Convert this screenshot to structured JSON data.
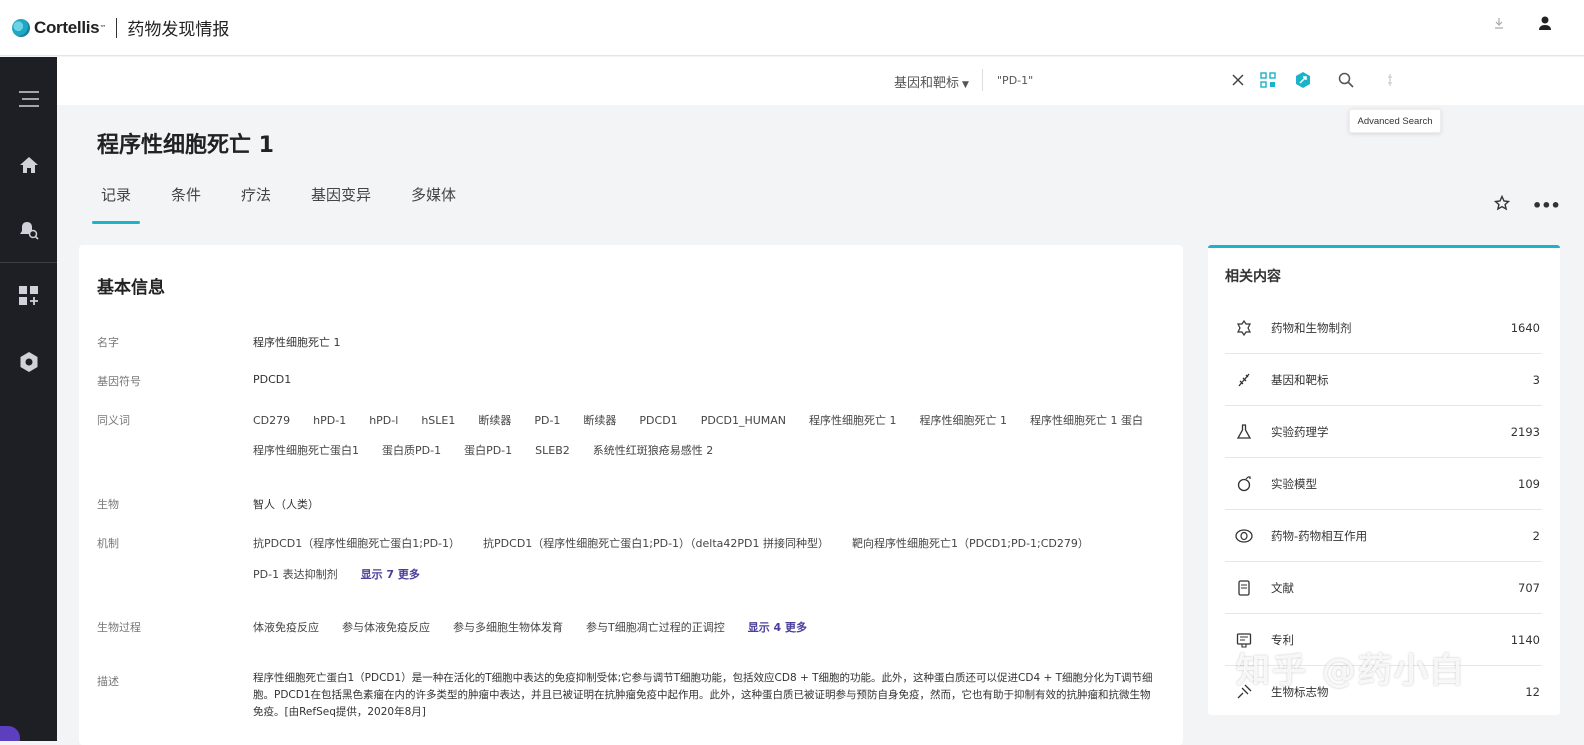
{
  "header": {
    "brand": "Cortellis",
    "app_title": "药物发现情报"
  },
  "search": {
    "scope": "基因和靶标",
    "query": "\"PD-1\"",
    "tooltip": "Advanced Search"
  },
  "page": {
    "title": "程序性细胞死亡 1",
    "tabs": [
      "记录",
      "条件",
      "疗法",
      "基因变异",
      "多媒体"
    ],
    "active_tab": "记录"
  },
  "basic_info": {
    "title": "基本信息",
    "name_label": "名字",
    "name_value": "程序性细胞死亡 1",
    "symbol_label": "基因符号",
    "symbol_value": "PDCD1",
    "synonyms_label": "同义词",
    "synonyms_row1": [
      "CD279",
      "hPD-1",
      "hPD-l",
      "hSLE1",
      "断续器",
      "PD-1",
      "断续器",
      "PDCD1",
      "PDCD1_HUMAN",
      "程序性细胞死亡 1",
      "程序性细胞死亡 1",
      "程序性细胞死亡 1 蛋白"
    ],
    "synonyms_row2": [
      "程序性细胞死亡蛋白1",
      "蛋白质PD-1",
      "蛋白PD-1",
      "SLEB2",
      "系统性红斑狼疮易感性 2"
    ],
    "organism_label": "生物",
    "organism_value": "智人（人类）",
    "mechanism_label": "机制",
    "mechanism_row1": [
      "抗PDCD1（程序性细胞死亡蛋白1;PD-1）",
      "抗PDCD1（程序性细胞死亡蛋白1;PD-1）（delta42PD1 拼接同种型）",
      "靶向程序性细胞死亡1（PDCD1;PD-1;CD279）"
    ],
    "mechanism_row2": [
      "PD-1 表达抑制剂"
    ],
    "mechanism_more": "显示 7 更多",
    "process_label": "生物过程",
    "process_items": [
      "体液免疫反应",
      "参与体液免疫反应",
      "参与多细胞生物体发育",
      "参与T细胞凋亡过程的正调控"
    ],
    "process_more": "显示 4 更多",
    "desc_label": "描述",
    "desc_text": "程序性细胞死亡蛋白1（PDCD1）是一种在活化的T细胞中表达的免疫抑制受体;它参与调节T细胞功能，包括效应CD8 + T细胞的功能。此外，这种蛋白质还可以促进CD4 + T细胞分化为T调节细胞。PDCD1在包括黑色素瘤在内的许多类型的肿瘤中表达，并且已被证明在抗肿瘤免疫中起作用。此外，这种蛋白质已被证明参与预防自身免疫，然而，它也有助于抑制有效的抗肿瘤和抗微生物免疫。[由RefSeq提供，2020年8月]"
  },
  "related": {
    "title": "相关内容",
    "items": [
      {
        "label": "药物和生物制剂",
        "count": "1640",
        "icon": "drug-icon"
      },
      {
        "label": "基因和靶标",
        "count": "3",
        "icon": "gene-icon"
      },
      {
        "label": "实验药理学",
        "count": "2193",
        "icon": "flask-icon"
      },
      {
        "label": "实验模型",
        "count": "109",
        "icon": "model-icon"
      },
      {
        "label": "药物-药物相互作用",
        "count": "2",
        "icon": "interaction-icon"
      },
      {
        "label": "文献",
        "count": "707",
        "icon": "literature-icon"
      },
      {
        "label": "专利",
        "count": "1140",
        "icon": "patent-icon"
      },
      {
        "label": "生物标志物",
        "count": "12",
        "icon": "biomarker-icon"
      }
    ]
  },
  "watermark": "知乎 @药小白"
}
